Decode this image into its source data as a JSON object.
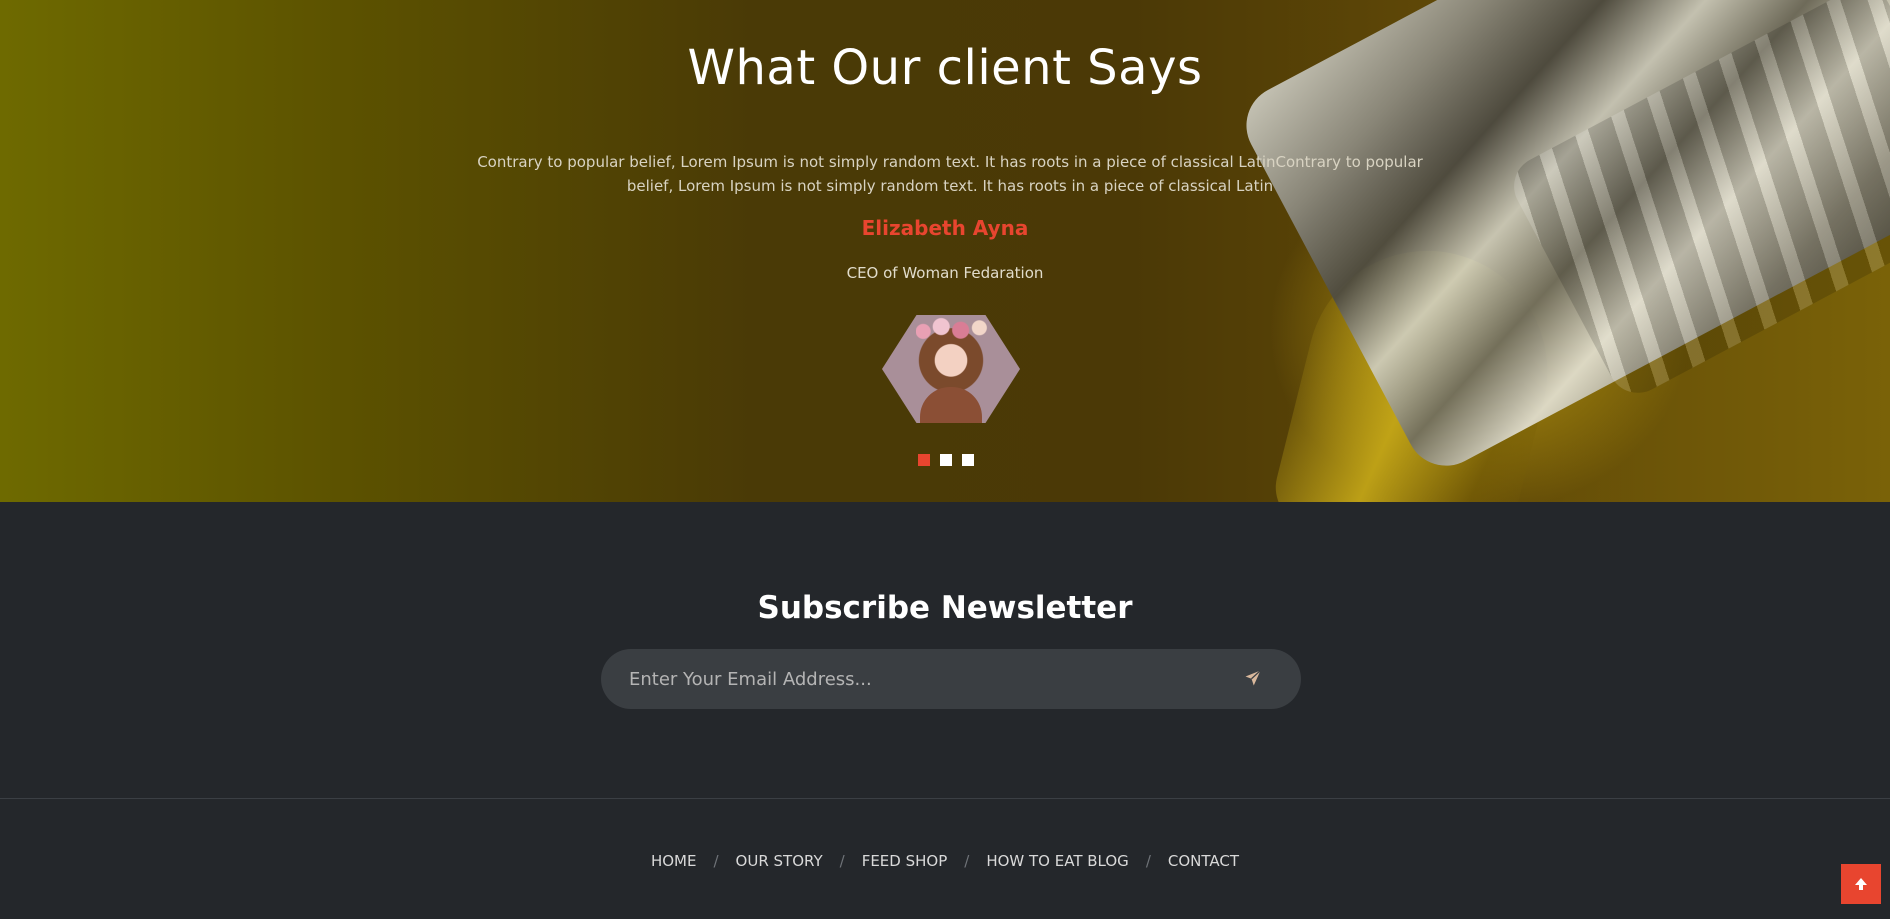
{
  "testimonial": {
    "title": "What Our client Says",
    "quote": "Contrary to popular belief, Lorem Ipsum is not simply random text. It has roots in a piece of classical LatinContrary to popular belief, Lorem Ipsum is not simply random text. It has roots in a piece of classical Latin",
    "author_name": "Elizabeth Ayna",
    "author_role": "CEO of Woman Fedaration",
    "slides_total": 3,
    "active_slide": 1
  },
  "newsletter": {
    "title": "Subscribe Newsletter",
    "email_placeholder": "Enter Your Email Address...",
    "send_icon": "paper-plane-icon"
  },
  "footer": {
    "nav": [
      "HOME",
      "OUR STORY",
      "FEED SHOP",
      "HOW TO EAT BLOG",
      "CONTACT"
    ],
    "separator": "/"
  },
  "scroll_top_icon": "arrow-up-icon",
  "colors": {
    "accent": "#e8452f",
    "dark_bg": "#24272b",
    "input_bg": "#3a3e42"
  }
}
